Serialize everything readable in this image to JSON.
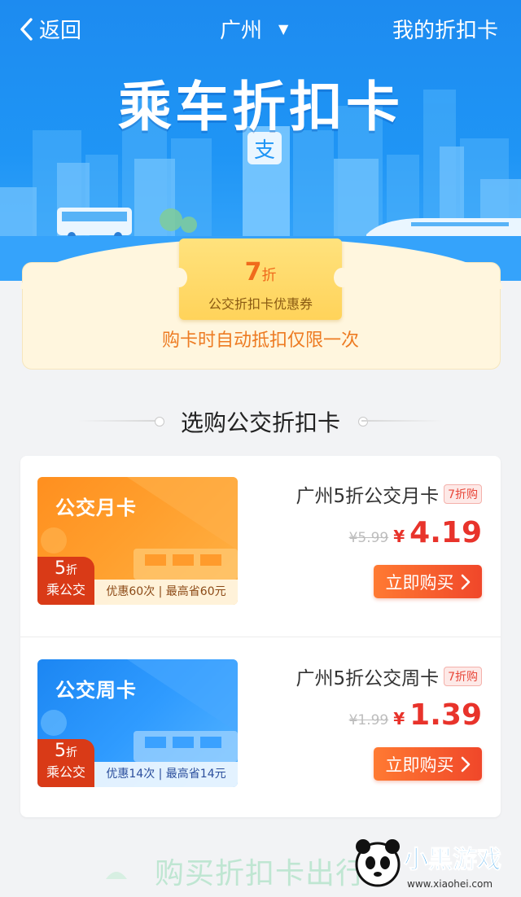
{
  "topbar": {
    "back_label": "返回",
    "city": "广州",
    "city_arrow": "▼",
    "my_card": "我的折扣卡"
  },
  "hero": {
    "title": "乘车折扣卡",
    "logo_char": "支"
  },
  "coupon": {
    "discount": "7",
    "discount_unit": "折",
    "name": "公交折扣卡优惠券",
    "note": "购卡时自动抵扣仅限一次"
  },
  "section_title": "选购公交折扣卡",
  "products": [
    {
      "card_name": "公交月卡",
      "badge_discount": "5",
      "badge_unit": "折",
      "badge_text": "乘公交",
      "card_footer": "优惠60次 | 最高省60元",
      "title": "广州5折公交月卡",
      "tag": "7折购",
      "old_price": "¥5.99",
      "currency": "¥",
      "price": "4.19",
      "buy_label": "立即购买"
    },
    {
      "card_name": "公交周卡",
      "badge_discount": "5",
      "badge_unit": "折",
      "badge_text": "乘公交",
      "card_footer": "优惠14次 | 最高省14元",
      "title": "广州5折公交周卡",
      "tag": "7折购",
      "old_price": "¥1.99",
      "currency": "¥",
      "price": "1.39",
      "buy_label": "立即购买"
    }
  ],
  "bottom_text": "购买折扣卡出行",
  "watermark": {
    "brand": "小黑游戏",
    "url": "www.xiaohei.com"
  },
  "colors": {
    "hero_blue": "#1f95f5",
    "price_red": "#e8332b",
    "buy_orange": "#ff7a32",
    "coupon_yellow": "#ffd35a",
    "note_orange": "#ed7b22"
  },
  "icons": [
    "back-chevron-icon",
    "dropdown-triangle-icon",
    "alipay-logo-icon",
    "bus-icon",
    "train-icon",
    "chevron-right-icon"
  ]
}
